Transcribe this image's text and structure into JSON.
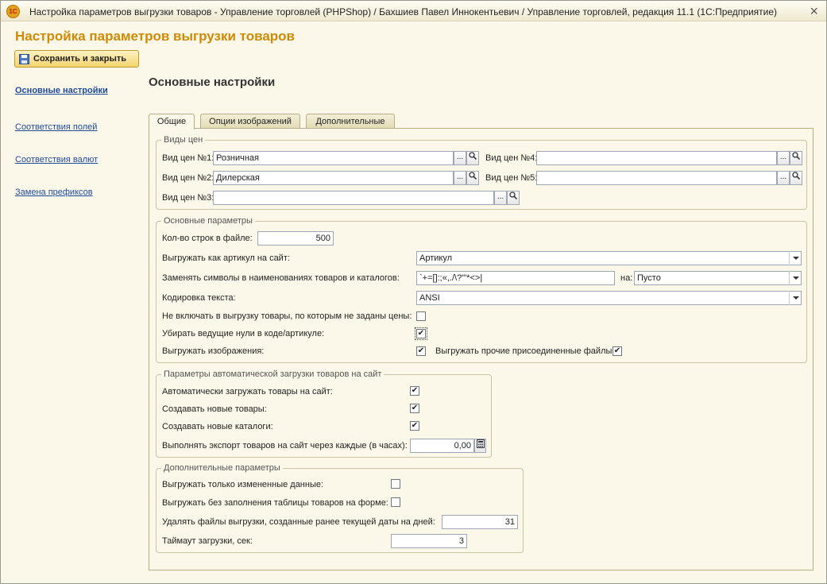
{
  "window": {
    "title": "Настройка параметров выгрузки товаров - Управление торговлей (PHPShop) / Бахшиев Павел Иннокентьевич / Управление торговлей, редакция 11.1  (1С:Предприятие)",
    "app_icon_text": "1С"
  },
  "form": {
    "title": "Настройка параметров выгрузки товаров"
  },
  "toolbar": {
    "save_close_label": "Сохранить и закрыть"
  },
  "nav": {
    "items": [
      {
        "label": "Основные настройки",
        "active": true
      },
      {
        "label": "Соответствия полей"
      },
      {
        "label": "Соответствия валют"
      },
      {
        "label": "Замена префиксов"
      }
    ]
  },
  "section": {
    "title": "Основные настройки"
  },
  "tabs": [
    {
      "label": "Общие",
      "active": true
    },
    {
      "label": "Опции изображений"
    },
    {
      "label": "Дополнительные"
    }
  ],
  "price_types": {
    "title": "Виды цен",
    "fields": [
      {
        "label": "Вид цен №1:",
        "value": "Розничная"
      },
      {
        "label": "Вид цен №2:",
        "value": "Дилерская"
      },
      {
        "label": "Вид цен №3:",
        "value": ""
      },
      {
        "label": "Вид цен №4:",
        "value": ""
      },
      {
        "label": "Вид цен №5:",
        "value": ""
      }
    ]
  },
  "main_params": {
    "title": "Основные параметры",
    "rows_label": "Кол-во строк в файле:",
    "rows_value": "500",
    "article_label": "Выгружать как артикул на сайт:",
    "article_value": "Артикул",
    "replace_label": "Заменять символы в наименованиях товаров и  каталогов:",
    "replace_value": "`+=[]:;«,./\\?\"'*<>|",
    "replace_to_label": "на:",
    "replace_to_value": "Пусто",
    "encoding_label": "Кодировка текста:",
    "encoding_value": "ANSI",
    "exclude_no_price_label": "Не включать в выгрузку товары, по которым не заданы цены:",
    "exclude_no_price_checked": false,
    "strip_zeros_label": "Убирать ведущие нули в коде/артикуле:",
    "strip_zeros_checked": true,
    "export_images_label": "Выгружать изображения:",
    "export_images_checked": true,
    "export_files_label": "Выгружать прочие присоединенные файлы:",
    "export_files_checked": true
  },
  "auto_params": {
    "title": "Параметры автоматической загрузки товаров на сайт",
    "auto_load_label": "Автоматически загружать товары на сайт:",
    "auto_load_checked": true,
    "create_products_label": "Создавать новые товары:",
    "create_products_checked": true,
    "create_catalogs_label": "Создавать новые каталоги:",
    "create_catalogs_checked": true,
    "interval_label": "Выполнять экспорт товаров на сайт через каждые (в часах):",
    "interval_value": "0,00"
  },
  "extra_params": {
    "title": "Дополнительные параметры",
    "changed_only_label": "Выгружать только измененные данные:",
    "changed_only_checked": false,
    "no_table_label": "Выгружать без заполнения таблицы товаров на форме:",
    "no_table_checked": false,
    "delete_files_label": "Удалять файлы выгрузки, созданные ранее текущей даты на дней:",
    "delete_files_value": "31",
    "timeout_label": "Таймаут загрузки, сек:",
    "timeout_value": "3"
  },
  "icons": {
    "checkmark": "✔",
    "pick": "...",
    "search": "search-icon",
    "calculator": "calculator-icon"
  }
}
